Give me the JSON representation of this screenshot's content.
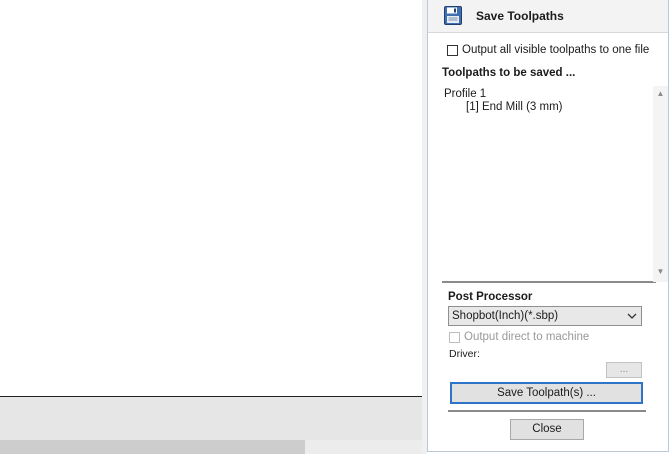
{
  "panel": {
    "title": "Save Toolpaths",
    "icon": "floppy-disk-icon",
    "output_all_label": "Output all visible toolpaths to one file",
    "toolpaths_heading": "Toolpaths to be saved ...",
    "toolpaths": [
      {
        "label": "Profile 1"
      },
      {
        "label": "[1] End Mill (3 mm)"
      }
    ],
    "post_processor_heading": "Post Processor",
    "post_processor_value": "Shopbot(Inch)(*.sbp)",
    "output_direct_label": "Output direct to machine",
    "driver_label": "Driver:",
    "browse_label": "...",
    "save_button_label": "Save Toolpath(s) ...",
    "close_button_label": "Close"
  },
  "colors": {
    "accent_focus": "#2f74c8",
    "panel_border": "#b9c9da"
  }
}
